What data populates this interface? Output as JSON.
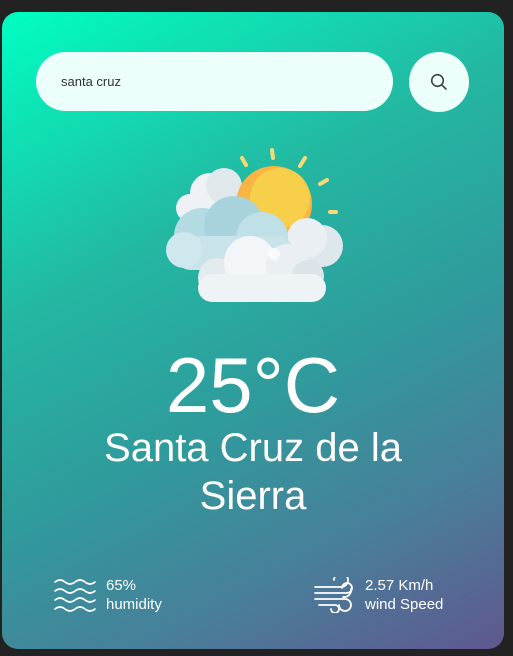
{
  "search": {
    "value": "santa cruz",
    "placeholder": "",
    "icon": "search-icon"
  },
  "weather": {
    "icon": "partly-cloudy-sun-icon",
    "temperature": "25°C",
    "city": "Santa Cruz de la Sierra"
  },
  "stats": {
    "humidity": {
      "icon": "waves-icon",
      "value": "65%",
      "label": "humidity"
    },
    "wind": {
      "icon": "wind-icon",
      "value": "2.57 Km/h",
      "label": "wind Speed"
    }
  },
  "colors": {
    "gradient_start": "#00ffc2",
    "gradient_end": "#5f578f",
    "search_bg": "#ecfffb",
    "text": "#ffffff"
  }
}
